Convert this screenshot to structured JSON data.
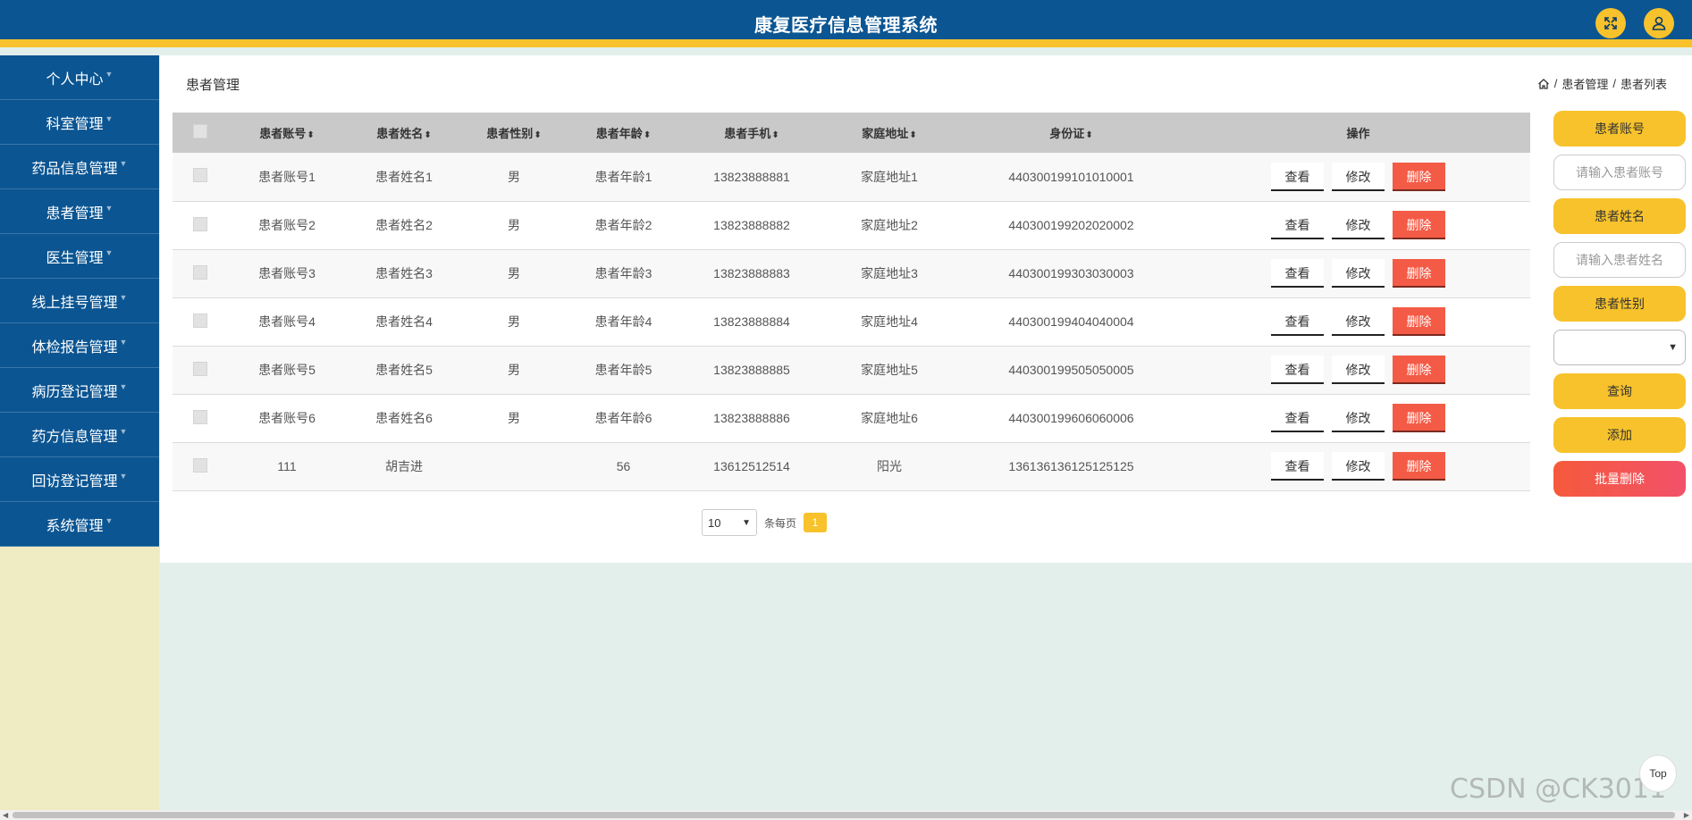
{
  "header": {
    "title": "康复医疗信息管理系统",
    "fullscreen_icon": "fullscreen-icon",
    "user_icon": "user-icon",
    "colors": {
      "primary": "#0b5592",
      "accent": "#f7c22b"
    }
  },
  "sidebar": {
    "items": [
      {
        "label": "个人中心"
      },
      {
        "label": "科室管理"
      },
      {
        "label": "药品信息管理"
      },
      {
        "label": "患者管理"
      },
      {
        "label": "医生管理"
      },
      {
        "label": "线上挂号管理"
      },
      {
        "label": "体检报告管理"
      },
      {
        "label": "病历登记管理"
      },
      {
        "label": "药方信息管理"
      },
      {
        "label": "回访登记管理"
      },
      {
        "label": "系统管理"
      }
    ]
  },
  "main": {
    "page_title": "患者管理",
    "breadcrumb": {
      "section": "患者管理",
      "sep": "/",
      "current": "患者列表"
    }
  },
  "table": {
    "columns": [
      "患者账号",
      "患者姓名",
      "患者性别",
      "患者年龄",
      "患者手机",
      "家庭地址",
      "身份证",
      "操作"
    ],
    "rows": [
      [
        "患者账号1",
        "患者姓名1",
        "男",
        "患者年龄1",
        "13823888881",
        "家庭地址1",
        "440300199101010001"
      ],
      [
        "患者账号2",
        "患者姓名2",
        "男",
        "患者年龄2",
        "13823888882",
        "家庭地址2",
        "440300199202020002"
      ],
      [
        "患者账号3",
        "患者姓名3",
        "男",
        "患者年龄3",
        "13823888883",
        "家庭地址3",
        "440300199303030003"
      ],
      [
        "患者账号4",
        "患者姓名4",
        "男",
        "患者年龄4",
        "13823888884",
        "家庭地址4",
        "440300199404040004"
      ],
      [
        "患者账号5",
        "患者姓名5",
        "男",
        "患者年龄5",
        "13823888885",
        "家庭地址5",
        "440300199505050005"
      ],
      [
        "患者账号6",
        "患者姓名6",
        "男",
        "患者年龄6",
        "13823888886",
        "家庭地址6",
        "440300199606060006"
      ],
      [
        "111",
        "胡吉进",
        "",
        "56",
        "13612512514",
        "阳光",
        "136136136125125125"
      ]
    ],
    "actions": {
      "view": "查看",
      "edit": "修改",
      "delete": "删除"
    }
  },
  "pagination": {
    "page_size": "10",
    "per_page_label": "条每页",
    "current_page": "1"
  },
  "search": {
    "account_label": "患者账号",
    "account_placeholder": "请输入患者账号",
    "name_label": "患者姓名",
    "name_placeholder": "请输入患者姓名",
    "gender_label": "患者性别",
    "gender_value": "",
    "query_button": "查询",
    "add_button": "添加",
    "batch_delete_button": "批量删除"
  },
  "back_to_top": "Top",
  "watermark": "CSDN @CK3011"
}
